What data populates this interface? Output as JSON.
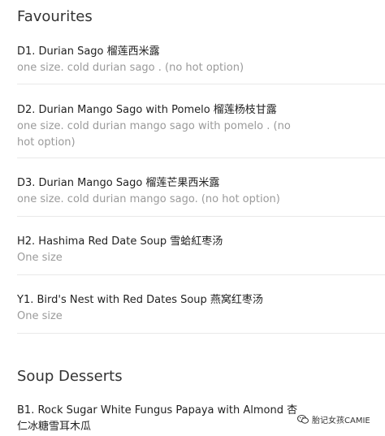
{
  "sections": [
    {
      "title": "Favourites"
    },
    {
      "title": "Soup Desserts"
    }
  ],
  "items": [
    {
      "name": "D1. Durian Sago 榴莲西米露",
      "desc": "one size. cold durian sago . (no hot option)"
    },
    {
      "name": "D2. Durian Mango Sago with Pomelo 榴莲杨枝甘露",
      "desc": "one size. cold durian mango sago with pomelo . (no hot option)"
    },
    {
      "name": "D3. Durian Mango Sago 榴莲芒果西米露",
      "desc": "one size. cold durian mango sago. (no hot option)"
    },
    {
      "name": "H2. Hashima Red Date Soup 雪蛤紅枣汤",
      "desc": "One size"
    },
    {
      "name": "Y1. Bird's Nest with Red Dates Soup 燕窝红枣汤",
      "desc": "One size"
    },
    {
      "name": "B1. Rock Sugar White Fungus Papaya with Almond 杏",
      "name_line2": "仁冰糖雪耳木瓜"
    }
  ],
  "watermark": {
    "text": "胎记女孩CAMIE",
    "icon": "wechat-icon"
  }
}
